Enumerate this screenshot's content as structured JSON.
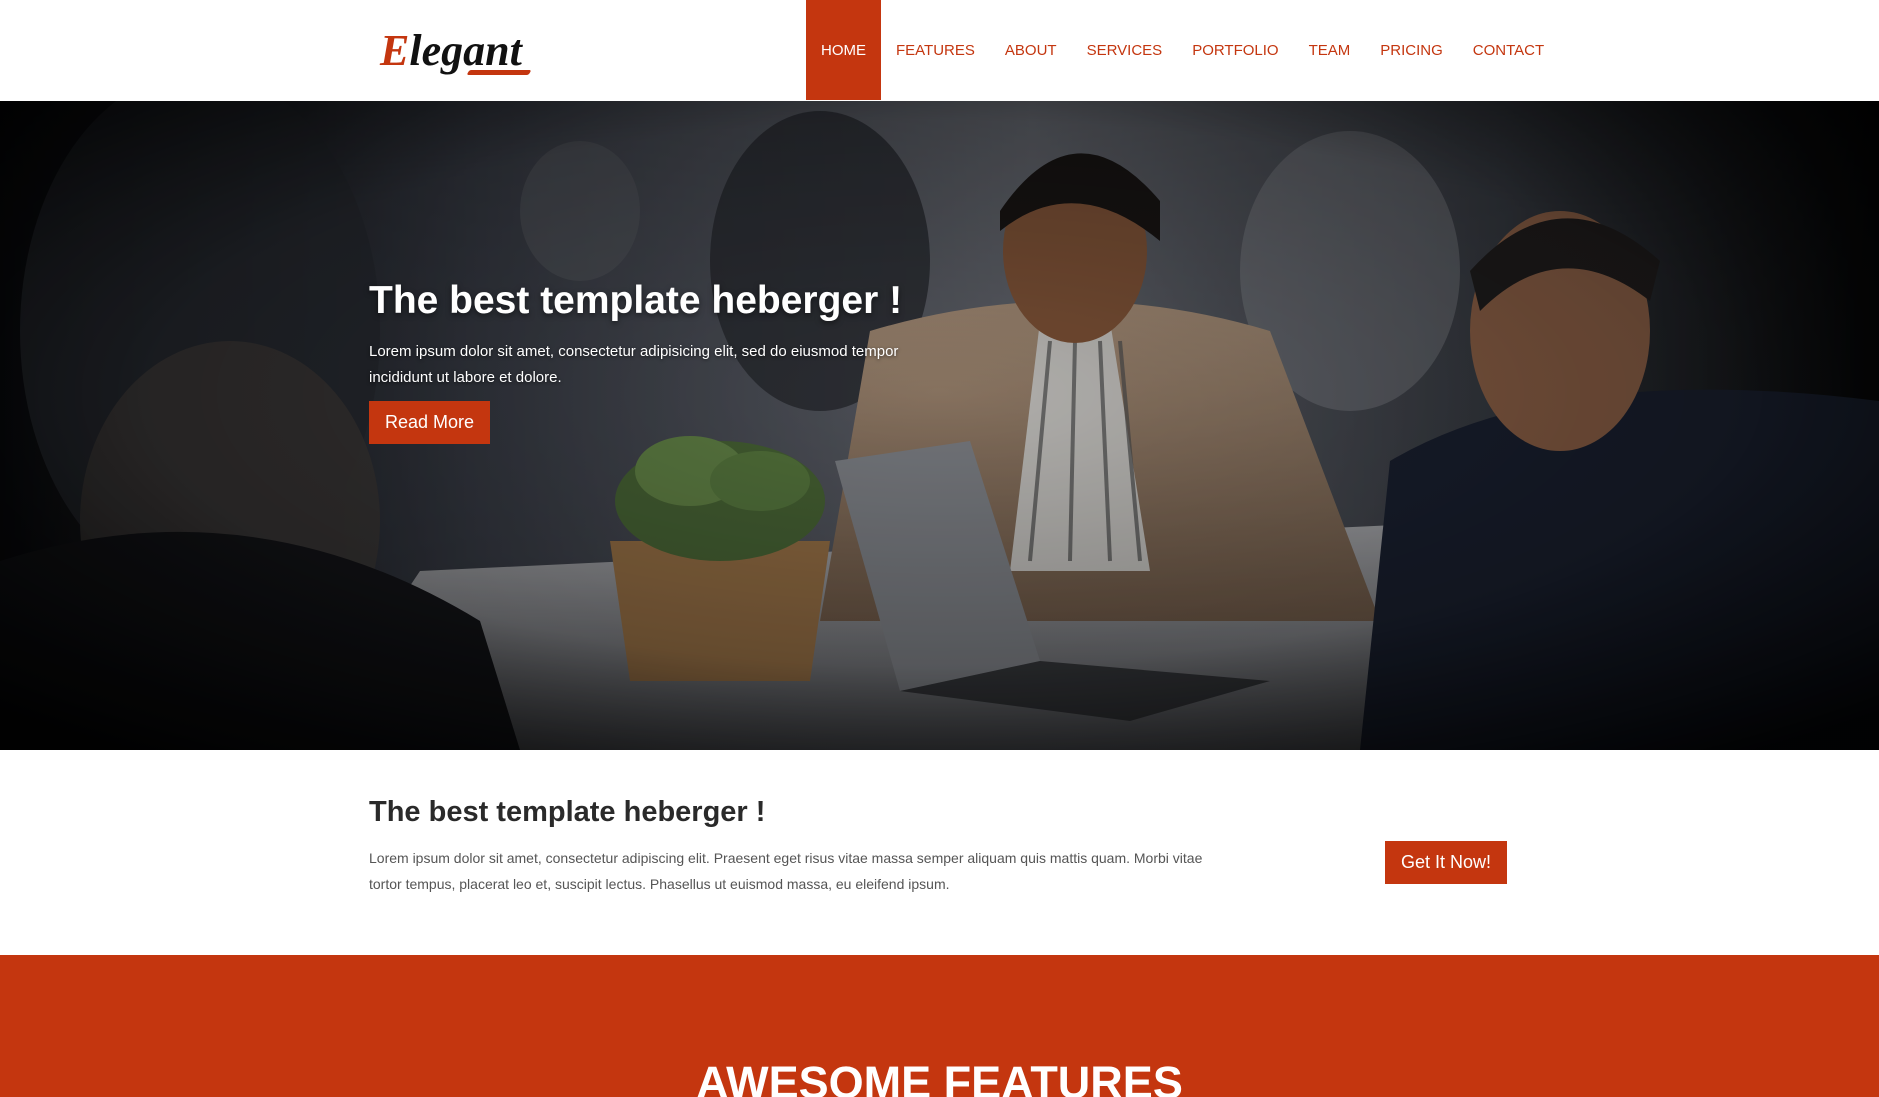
{
  "colors": {
    "accent": "#c4360f",
    "heading": "#2a2a2a",
    "body_text": "#555555",
    "white": "#ffffff"
  },
  "header": {
    "logo_text": "Elegant",
    "logo_first_letter": "E",
    "logo_rest": "legant",
    "nav": [
      {
        "label": "HOME",
        "active": true
      },
      {
        "label": "FEATURES",
        "active": false
      },
      {
        "label": "ABOUT",
        "active": false
      },
      {
        "label": "SERVICES",
        "active": false
      },
      {
        "label": "PORTFOLIO",
        "active": false
      },
      {
        "label": "TEAM",
        "active": false
      },
      {
        "label": "PRICING",
        "active": false
      },
      {
        "label": "CONTACT",
        "active": false
      }
    ]
  },
  "hero": {
    "title": "The best template heberger !",
    "text": "Lorem ipsum dolor sit amet, consectetur adipisicing elit, sed do eiusmod tempor incididunt ut labore et dolore.",
    "button_label": "Read More",
    "image": "business-meeting-photo"
  },
  "cta": {
    "title": "The best template heberger !",
    "text": "Lorem ipsum dolor sit amet, consectetur adipiscing elit. Praesent eget risus vitae massa semper aliquam quis mattis quam. Morbi vitae tortor tempus, placerat leo et, suscipit lectus. Phasellus ut euismod massa, eu eleifend ipsum.",
    "button_label": "Get It Now!"
  },
  "features": {
    "title": "AWESOME FEATURES"
  }
}
